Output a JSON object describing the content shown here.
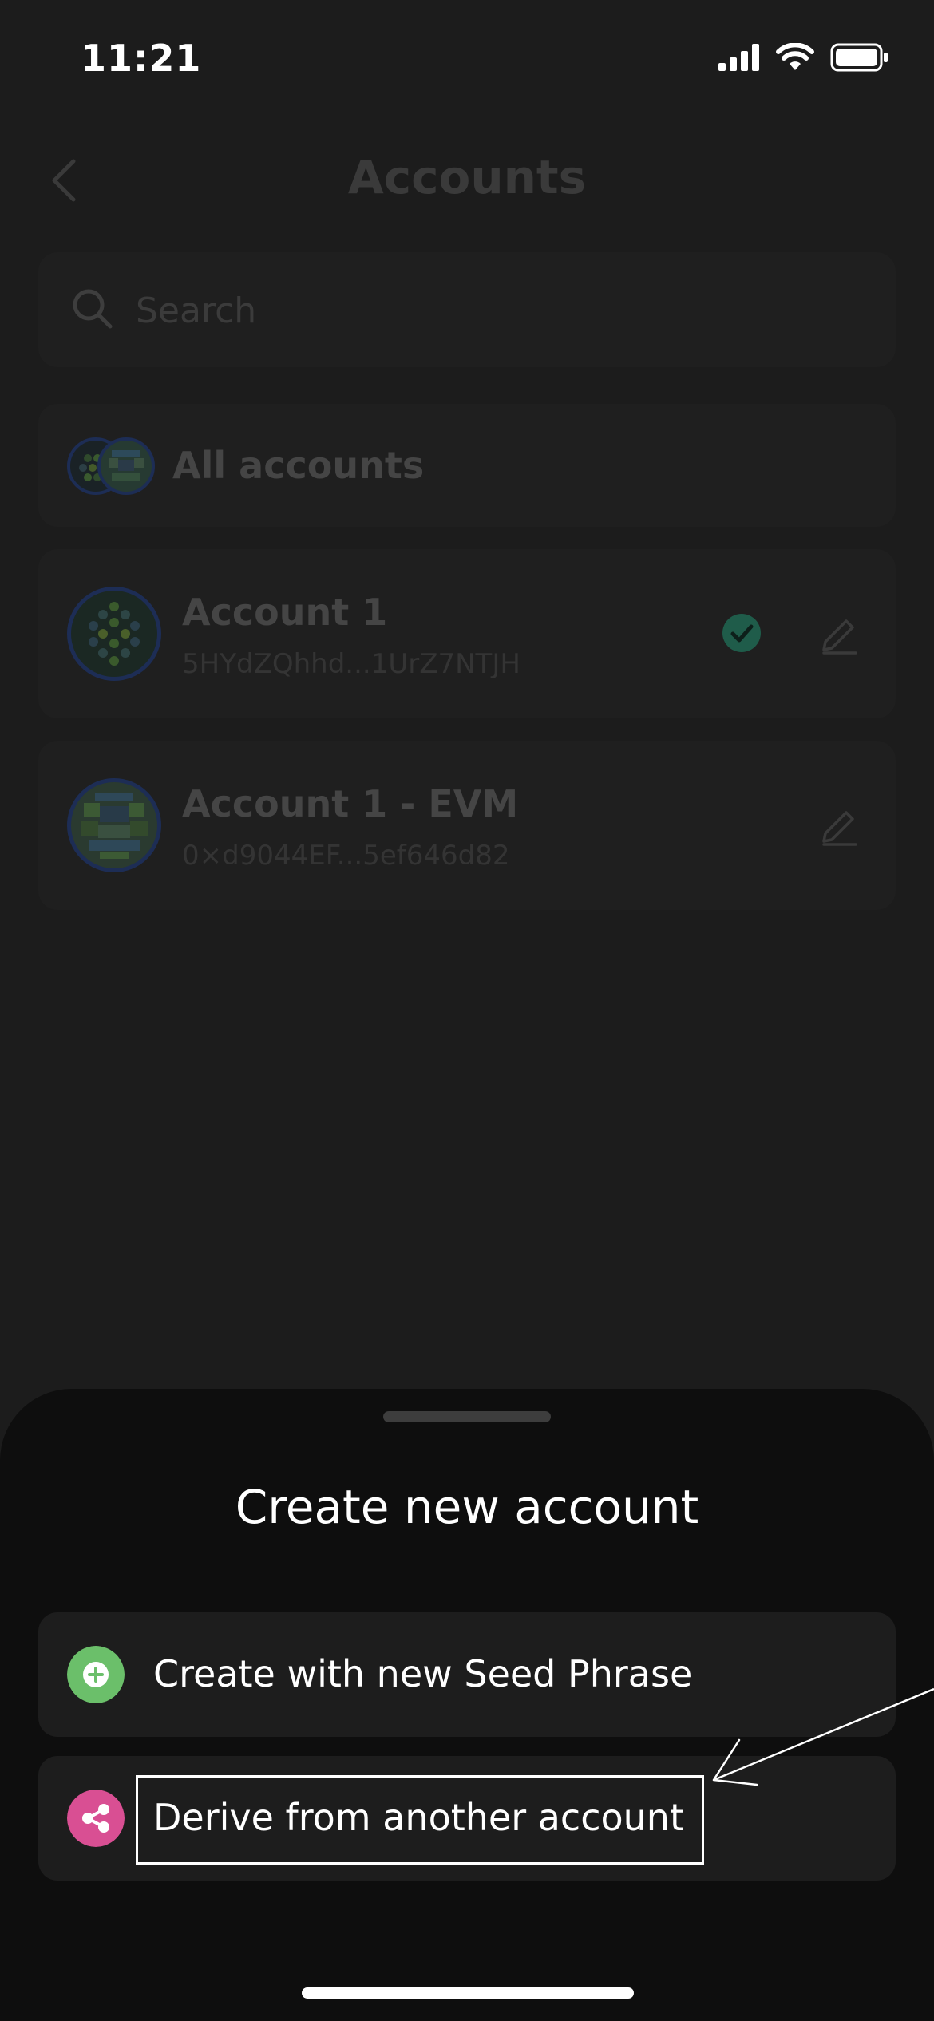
{
  "status_bar": {
    "time": "11:21"
  },
  "header": {
    "title": "Accounts"
  },
  "search": {
    "placeholder": "Search"
  },
  "all_accounts": {
    "label": "All accounts"
  },
  "accounts": [
    {
      "name": "Account 1",
      "address": "5HYdZQhhd...1UrZ7NTJH",
      "selected": true
    },
    {
      "name": "Account 1 - EVM",
      "address": "0×d9044EF...5ef646d82",
      "selected": false
    }
  ],
  "sheet": {
    "title": "Create new account",
    "options": [
      {
        "label": "Create with new Seed Phrase",
        "icon": "plus-circle-icon",
        "color": "#6bbf6a"
      },
      {
        "label": "Derive from another account",
        "icon": "share-icon",
        "color": "#d94f93"
      }
    ]
  },
  "colors": {
    "background": "#1c1c1c",
    "sheet": "#0e0e0e",
    "check": "#1f5c4a"
  }
}
